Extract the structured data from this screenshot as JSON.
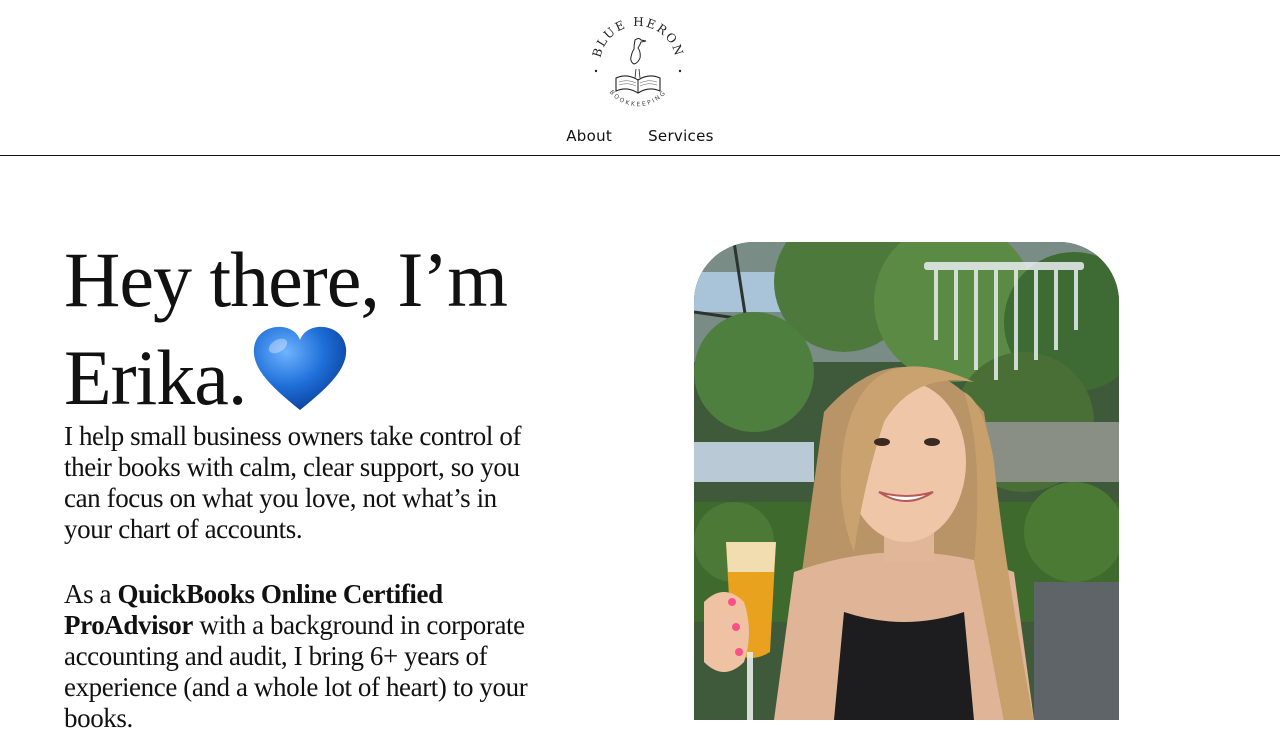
{
  "logo": {
    "top_text": "BLUE HERON",
    "bottom_text": "BOOKKEEPING"
  },
  "nav": {
    "items": [
      {
        "label": "About"
      },
      {
        "label": "Services"
      }
    ]
  },
  "hero": {
    "title": "Hey there, I’m Erika.",
    "heart_emoji": "💙",
    "intro": "I help small business owners take control of their books with calm, clear support, so you can focus on what you love, not what’s in your chart of accounts.",
    "experience_prefix": "As a ",
    "experience_bold": "QuickBooks Online Certified ProAdvisor",
    "experience_suffix": " with a background in corporate accounting and audit, I bring 6+ years of experience (and a whole lot of heart) to your books."
  },
  "colors": {
    "text": "#111111",
    "background": "#ffffff",
    "heart": "#1e6fd9"
  }
}
